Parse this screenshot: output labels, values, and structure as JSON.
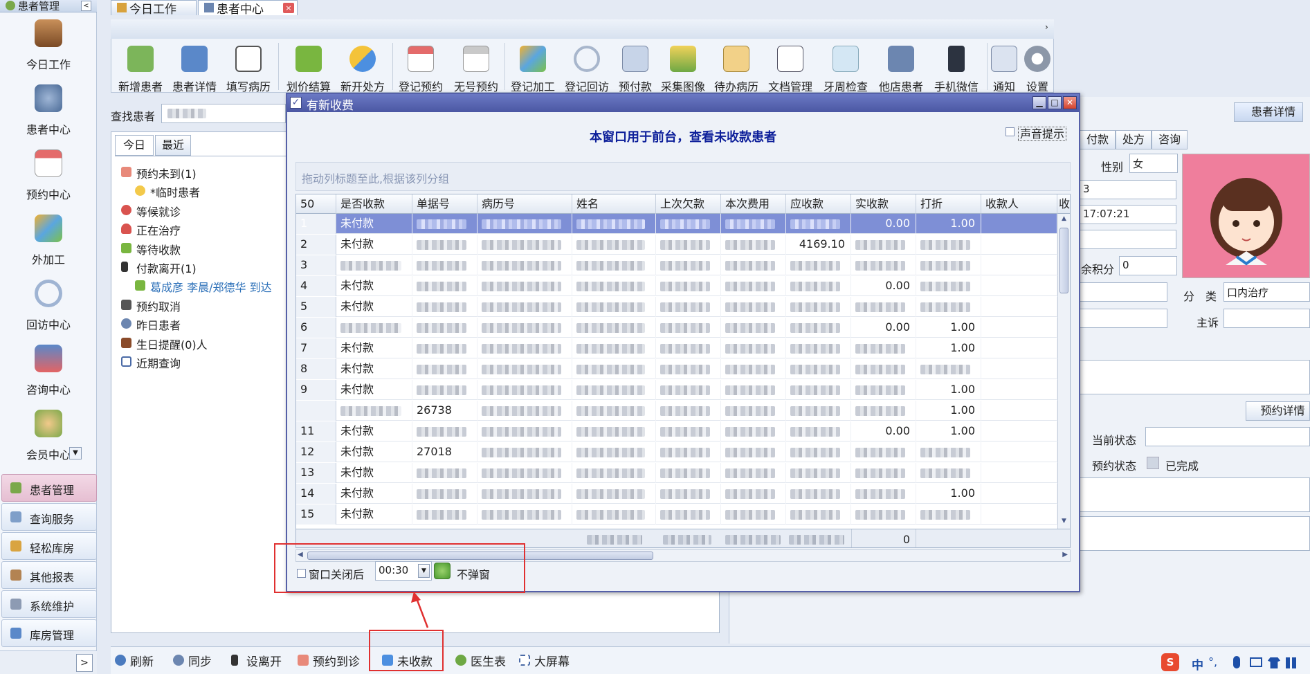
{
  "tabs": [
    {
      "label": "今日工作"
    },
    {
      "label": "患者中心"
    }
  ],
  "sidebar": {
    "title": "患者管理",
    "big_items": [
      {
        "label": "今日工作"
      },
      {
        "label": "患者中心"
      },
      {
        "label": "预约中心"
      },
      {
        "label": "外加工"
      },
      {
        "label": "回访中心"
      },
      {
        "label": "咨询中心"
      },
      {
        "label": "会员中心"
      }
    ],
    "nav": [
      {
        "label": "患者管理"
      },
      {
        "label": "查询服务"
      },
      {
        "label": "轻松库房"
      },
      {
        "label": "其他报表"
      },
      {
        "label": "系统维护"
      },
      {
        "label": "库房管理"
      }
    ]
  },
  "toolbar": {
    "tools": [
      {
        "label": "新增患者"
      },
      {
        "label": "患者详情"
      },
      {
        "label": "填写病历"
      },
      {
        "label": "划价结算"
      },
      {
        "label": "新开处方"
      },
      {
        "label": "登记预约"
      },
      {
        "label": "无号预约"
      },
      {
        "label": "登记加工"
      },
      {
        "label": "登记回访"
      },
      {
        "label": "预付款"
      },
      {
        "label": "采集图像"
      },
      {
        "label": "待办病历"
      },
      {
        "label": "文档管理"
      },
      {
        "label": "牙周检查"
      },
      {
        "label": "他店患者"
      },
      {
        "label": "手机微信"
      },
      {
        "label": "通知"
      },
      {
        "label": "设置"
      }
    ]
  },
  "search": {
    "label": "查找患者"
  },
  "left_tabs": [
    {
      "label": "今日"
    },
    {
      "label": "最近"
    }
  ],
  "tree": [
    {
      "label": "预约未到(1)"
    },
    {
      "label": "*临时患者"
    },
    {
      "label": "等候就诊"
    },
    {
      "label": "正在治疗"
    },
    {
      "label": "等待收款"
    },
    {
      "label": "付款离开(1)"
    },
    {
      "label": "葛成彦 李晨/郑德华 到达"
    },
    {
      "label": "预约取消"
    },
    {
      "label": "昨日患者"
    },
    {
      "label": "生日提醒(0)人"
    },
    {
      "label": "近期查询"
    }
  ],
  "right": {
    "detail_btn": "患者详情",
    "tabs": [
      {
        "label": "付款"
      },
      {
        "label": "处方"
      },
      {
        "label": "咨询"
      }
    ],
    "gender_label": "性别",
    "gender": "女",
    "time": "17:07:21",
    "id_tail": "3",
    "points_label": "余积分",
    "points": "0",
    "category_label": "分　类",
    "category": "口内治疗",
    "complaint_label": "主诉",
    "appt_btn": "预约详情",
    "current_state_label": "当前状态",
    "appt_state_label": "预约状态",
    "appt_state": "已完成"
  },
  "statusbar": [
    {
      "label": "刷新"
    },
    {
      "label": "同步"
    },
    {
      "label": "设离开"
    },
    {
      "label": "预约到诊"
    },
    {
      "label": "未收款"
    },
    {
      "label": "医生表"
    },
    {
      "label": "大屏幕"
    }
  ],
  "ime": "中",
  "dialog": {
    "title": "有新收费",
    "headline": "本窗口用于前台，查看未收款患者",
    "sound": "声音提示",
    "group_hint": "拖动列标题至此,根据该列分组",
    "columns": [
      "50",
      "是否收款",
      "单据号",
      "病历号",
      "姓名",
      "上次欠款",
      "本次费用",
      "应收款",
      "实收款",
      "打折",
      "收款人",
      "收"
    ],
    "rows": [
      {
        "no": "1",
        "status": "未付款",
        "bill": "",
        "paid": "0.00",
        "discount": "1.00"
      },
      {
        "no": "2",
        "status": "未付款",
        "bill": "",
        "receivable": "4169.10",
        "paid": "",
        "discount": ""
      },
      {
        "no": "3",
        "status": "",
        "bill": "",
        "paid": "",
        "discount": ""
      },
      {
        "no": "4",
        "status": "未付款",
        "bill": "",
        "paid": "0.00",
        "discount": ""
      },
      {
        "no": "5",
        "status": "未付款",
        "bill": "",
        "paid": "",
        "discount": ""
      },
      {
        "no": "6",
        "status": "",
        "bill": "",
        "paid": "0.00",
        "discount": "1.00"
      },
      {
        "no": "7",
        "status": "未付款",
        "bill": "",
        "paid": "",
        "discount": "1.00"
      },
      {
        "no": "8",
        "status": "未付款",
        "bill": "",
        "paid": "",
        "discount": ""
      },
      {
        "no": "9",
        "status": "未付款",
        "bill": "",
        "paid": "",
        "discount": "1.00"
      },
      {
        "no": "",
        "status": "",
        "bill": "26738",
        "paid": "",
        "discount": "1.00"
      },
      {
        "no": "11",
        "status": "未付款",
        "bill": "",
        "paid": "0.00",
        "discount": "1.00"
      },
      {
        "no": "12",
        "status": "未付款",
        "bill": "27018",
        "paid": "",
        "discount": ""
      },
      {
        "no": "13",
        "status": "未付款",
        "bill": "",
        "paid": "",
        "discount": ""
      },
      {
        "no": "14",
        "status": "未付款",
        "bill": "",
        "paid": "",
        "discount": "1.00"
      },
      {
        "no": "15",
        "status": "未付款",
        "bill": "",
        "paid": "",
        "discount": ""
      }
    ],
    "footer_paid": "0",
    "close_after_label": "窗口关闭后",
    "close_after_value": "00:30",
    "no_popup": "不弹窗"
  },
  "colors": {
    "accent": "#4b57a3",
    "selected_row": "#7e8fd6",
    "headline": "#0d1f9a",
    "highlight": "#e03030"
  }
}
